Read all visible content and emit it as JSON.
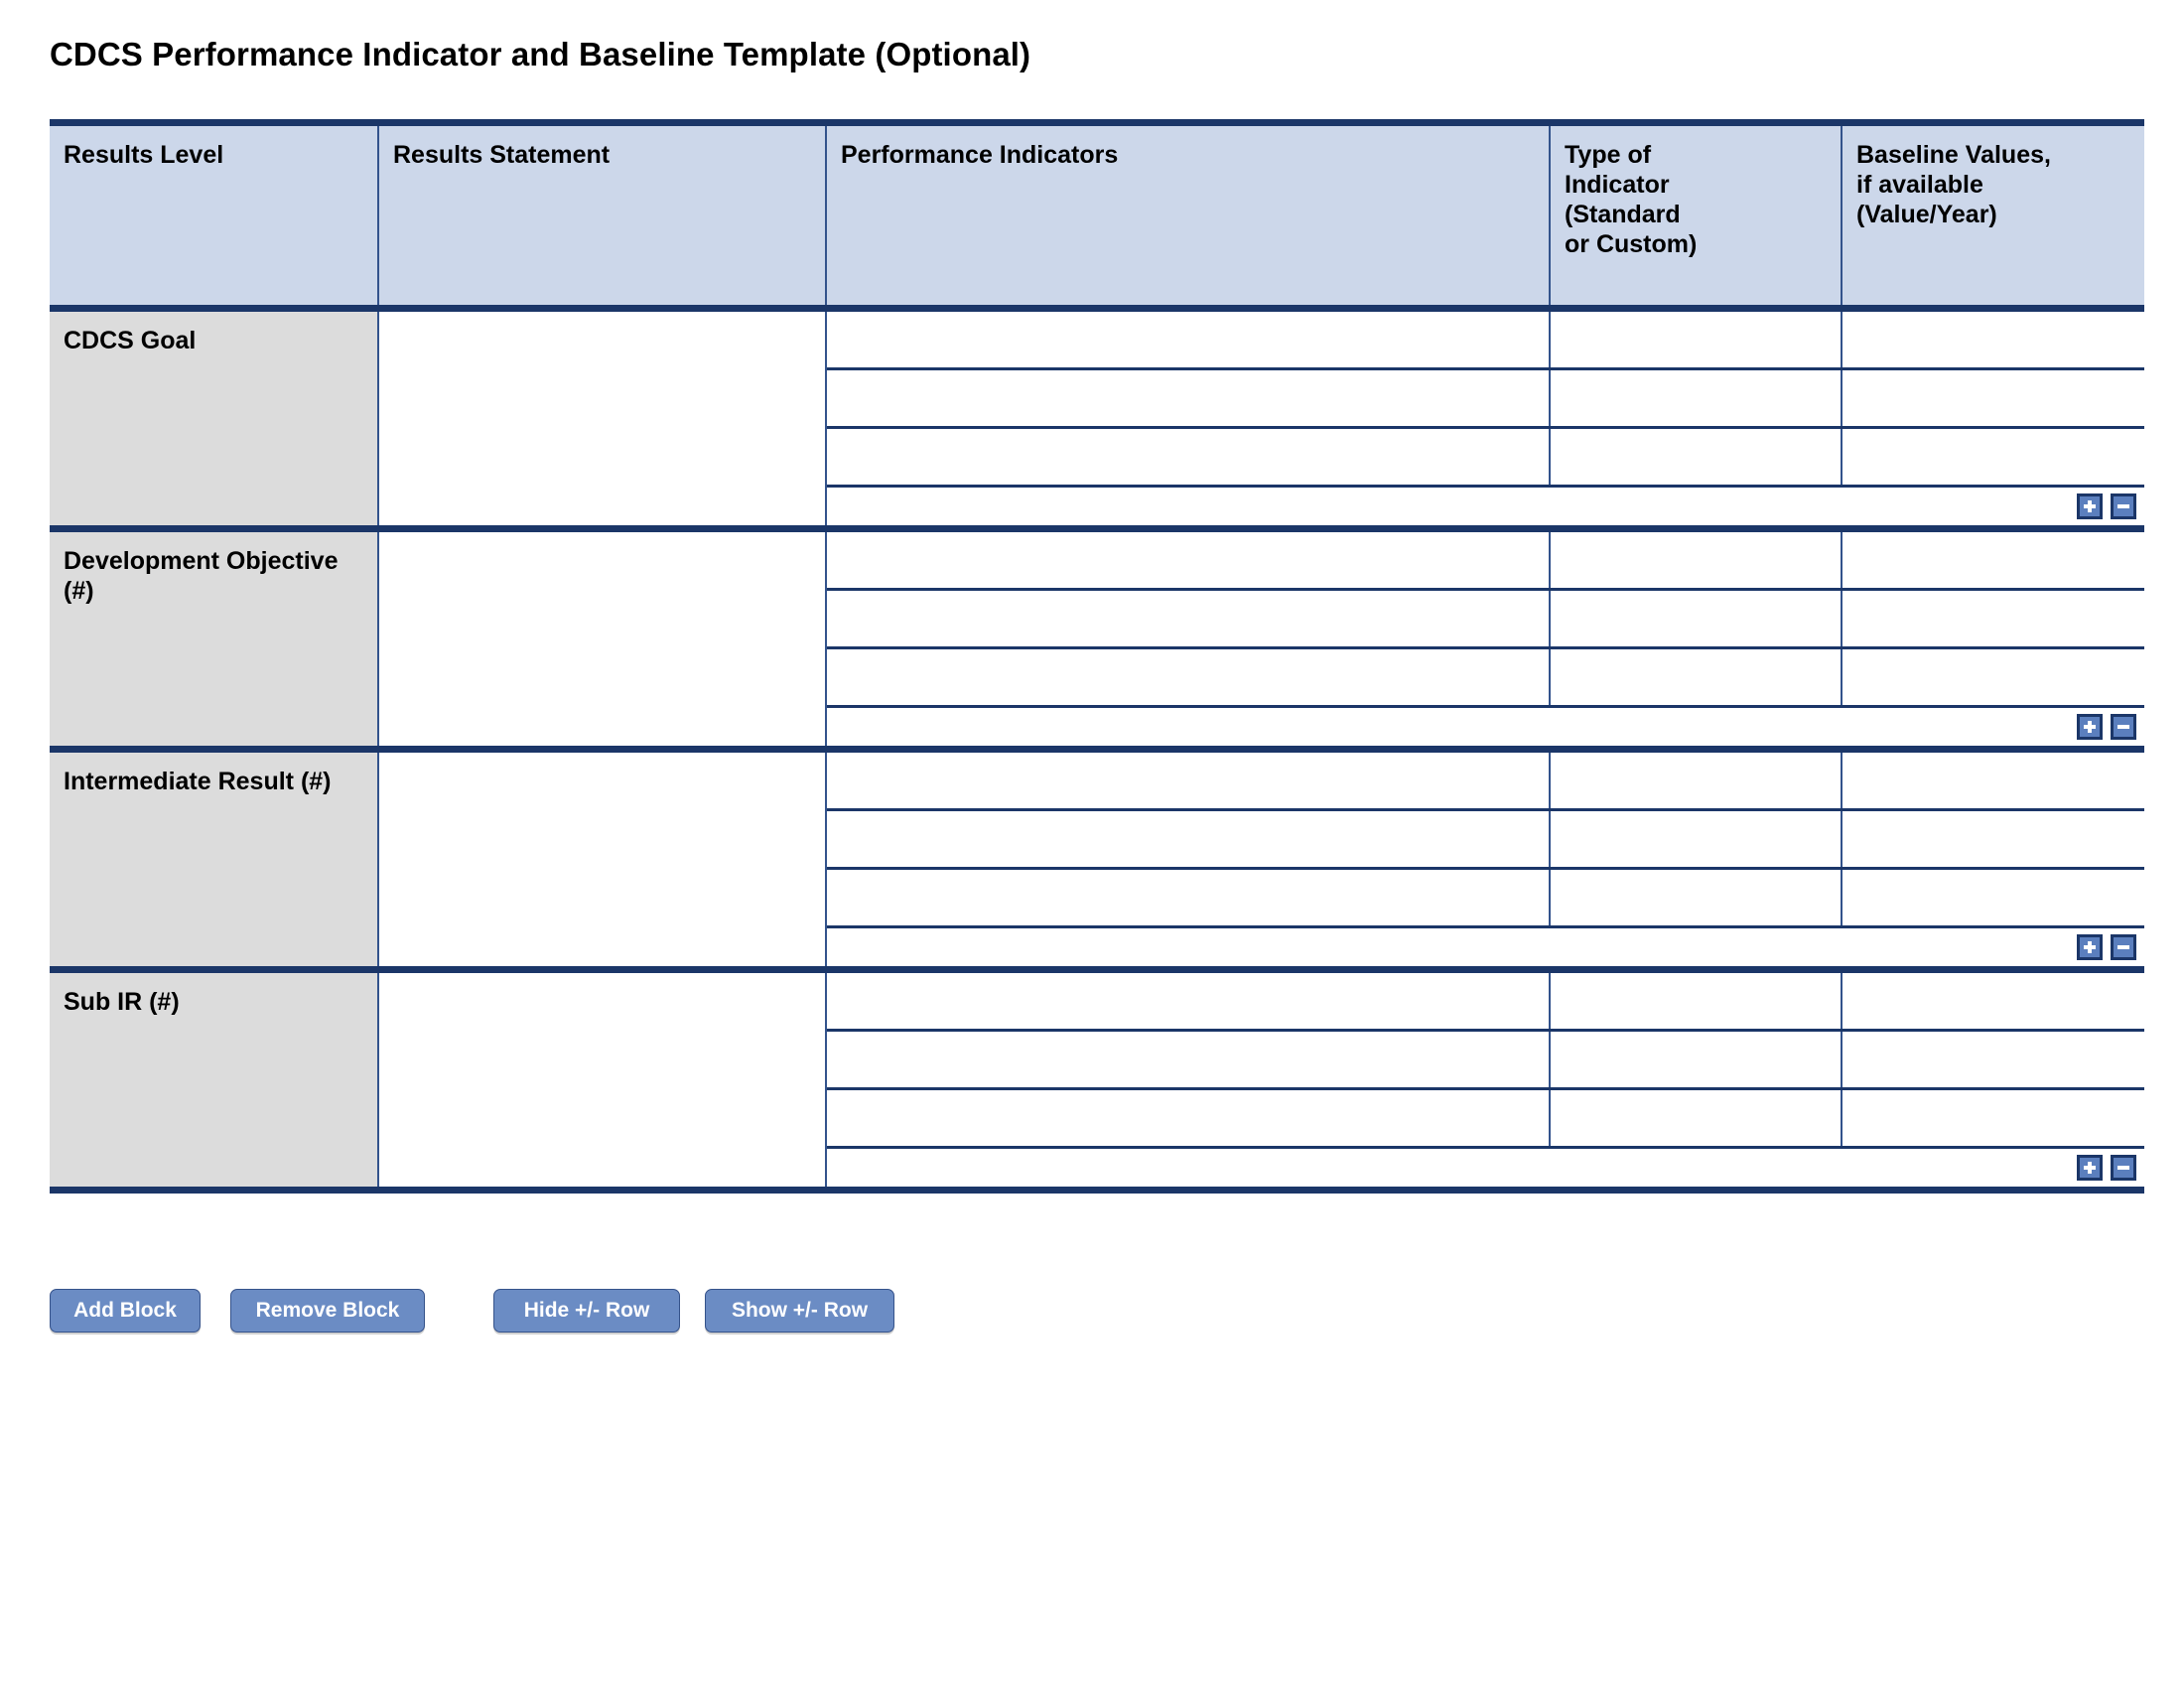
{
  "document": {
    "title": "CDCS Performance Indicator and Baseline Template (Optional)"
  },
  "table": {
    "columns": [
      {
        "key": "results_level",
        "label": "Results Level"
      },
      {
        "key": "results_statement",
        "label": "Results Statement"
      },
      {
        "key": "performance_indicators",
        "label": "Performance Indicators"
      },
      {
        "key": "type_of_indicator",
        "label": "Type of\nIndicator\n(Standard\nor Custom)"
      },
      {
        "key": "baseline_values",
        "label": "Baseline Values,\nif available\n(Value/Year)"
      }
    ],
    "blocks": [
      {
        "level_label": "CDCS Goal",
        "results_statement": "",
        "rows": [
          {
            "performance_indicator": "",
            "type_of_indicator": "",
            "baseline_value": ""
          },
          {
            "performance_indicator": "",
            "type_of_indicator": "",
            "baseline_value": ""
          },
          {
            "performance_indicator": "",
            "type_of_indicator": "",
            "baseline_value": ""
          }
        ],
        "add_row_label": "+",
        "remove_row_label": "−"
      },
      {
        "level_label": "Development Objective (#)",
        "results_statement": "",
        "rows": [
          {
            "performance_indicator": "",
            "type_of_indicator": "",
            "baseline_value": ""
          },
          {
            "performance_indicator": "",
            "type_of_indicator": "",
            "baseline_value": ""
          },
          {
            "performance_indicator": "",
            "type_of_indicator": "",
            "baseline_value": ""
          }
        ],
        "add_row_label": "+",
        "remove_row_label": "−"
      },
      {
        "level_label": "Intermediate Result (#)",
        "results_statement": "",
        "rows": [
          {
            "performance_indicator": "",
            "type_of_indicator": "",
            "baseline_value": ""
          },
          {
            "performance_indicator": "",
            "type_of_indicator": "",
            "baseline_value": ""
          },
          {
            "performance_indicator": "",
            "type_of_indicator": "",
            "baseline_value": ""
          }
        ],
        "add_row_label": "+",
        "remove_row_label": "−"
      },
      {
        "level_label": "Sub IR (#)",
        "results_statement": "",
        "rows": [
          {
            "performance_indicator": "",
            "type_of_indicator": "",
            "baseline_value": ""
          },
          {
            "performance_indicator": "",
            "type_of_indicator": "",
            "baseline_value": ""
          },
          {
            "performance_indicator": "",
            "type_of_indicator": "",
            "baseline_value": ""
          }
        ],
        "add_row_label": "+",
        "remove_row_label": "−"
      }
    ]
  },
  "actions": {
    "add_block": "Add Block",
    "remove_block": "Remove Block",
    "hide_plus_minus_row": "Hide +/- Row",
    "show_plus_minus_row": "Show +/- Row"
  },
  "colors": {
    "header_fill": "#ccd7ea",
    "level_fill": "#dcdcdc",
    "border_heavy": "#1b3668",
    "border_light": "#33538c",
    "button_fill": "#6b8cc4",
    "small_button_fill": "#5b7fbe"
  }
}
